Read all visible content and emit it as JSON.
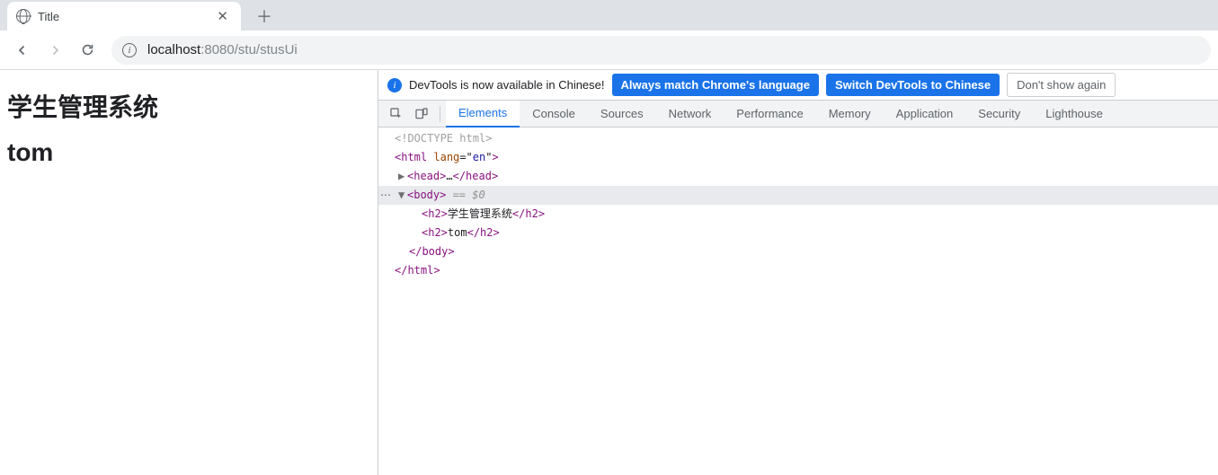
{
  "browser": {
    "tab_title": "Title",
    "url_host": "localhost",
    "url_port": ":8080",
    "url_path": "/stu/stusUi"
  },
  "page": {
    "heading1": "学生管理系统",
    "heading2": "tom"
  },
  "infobar": {
    "message": "DevTools is now available in Chinese!",
    "btn_match": "Always match Chrome's language",
    "btn_switch": "Switch DevTools to Chinese",
    "btn_dismiss": "Don't show again"
  },
  "devtools_tabs": {
    "elements": "Elements",
    "console": "Console",
    "sources": "Sources",
    "network": "Network",
    "performance": "Performance",
    "memory": "Memory",
    "application": "Application",
    "security": "Security",
    "lighthouse": "Lighthouse"
  },
  "dom": {
    "doctype": "<!DOCTYPE html>",
    "html_open_1": "<",
    "html_tag": "html",
    "html_attr": "lang",
    "html_attrval": "en",
    "html_open_2": ">",
    "head_open": "<head>",
    "head_ellipsis": "…",
    "head_close": "</head>",
    "body_open": "<body>",
    "body_sel": " == $0",
    "h2a_open": "<h2>",
    "h2a_text": "学生管理系统",
    "h2a_close": "</h2>",
    "h2b_open": "<h2>",
    "h2b_text": "tom",
    "h2b_close": "</h2>",
    "body_close": "</body>",
    "html_close": "</html>"
  }
}
